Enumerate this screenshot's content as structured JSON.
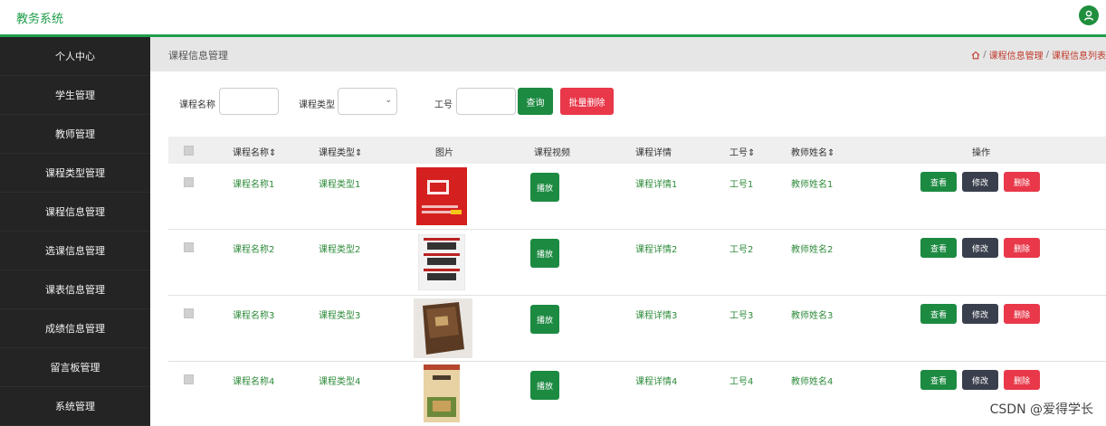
{
  "app": {
    "title": "教务系统"
  },
  "sidebar": {
    "items": [
      "个人中心",
      "学生管理",
      "教师管理",
      "课程类型管理",
      "课程信息管理",
      "选课信息管理",
      "课表信息管理",
      "成绩信息管理",
      "留言板管理",
      "系统管理"
    ]
  },
  "header": {
    "page_title": "课程信息管理",
    "breadcrumb": [
      "课程信息管理",
      "课程信息列表"
    ]
  },
  "search": {
    "course_name_label": "课程名称",
    "course_type_label": "课程类型",
    "teacher_id_label": "工号",
    "course_name_value": "",
    "course_type_value": "",
    "teacher_id_value": "",
    "search_button": "查询",
    "batch_delete_button": "批量删除"
  },
  "table": {
    "headers": {
      "name": "课程名称",
      "type": "课程类型",
      "image": "图片",
      "video": "课程视频",
      "detail": "课程详情",
      "teacher_id": "工号",
      "teacher_name": "教师姓名",
      "actions": "操作"
    },
    "sort_icon": "sort-arrows-icon",
    "rows": [
      {
        "name": "课程名称1",
        "type": "课程类型1",
        "video_button": "播放",
        "detail": "课程详情1",
        "teacher_id": "工号1",
        "teacher_name": "教师姓名1",
        "view": "查看",
        "edit": "修改",
        "delete": "删除"
      },
      {
        "name": "课程名称2",
        "type": "课程类型2",
        "video_button": "播放",
        "detail": "课程详情2",
        "teacher_id": "工号2",
        "teacher_name": "教师姓名2",
        "view": "查看",
        "edit": "修改",
        "delete": "删除"
      },
      {
        "name": "课程名称3",
        "type": "课程类型3",
        "video_button": "播放",
        "detail": "课程详情3",
        "teacher_id": "工号3",
        "teacher_name": "教师姓名3",
        "view": "查看",
        "edit": "修改",
        "delete": "删除"
      },
      {
        "name": "课程名称4",
        "type": "课程类型4",
        "video_button": "播放",
        "detail": "课程详情4",
        "teacher_id": "工号4",
        "teacher_name": "教师姓名4",
        "view": "查看",
        "edit": "修改",
        "delete": "删除"
      }
    ]
  },
  "colors": {
    "brand": "#1f9d4a",
    "sidebar_bg": "#242424",
    "primary_button": "#1d8a42",
    "danger_button": "#e8384a",
    "edit_button": "#3a3f4d",
    "link_text": "#2e8b3a"
  },
  "watermark": "CSDN @爱得学长"
}
